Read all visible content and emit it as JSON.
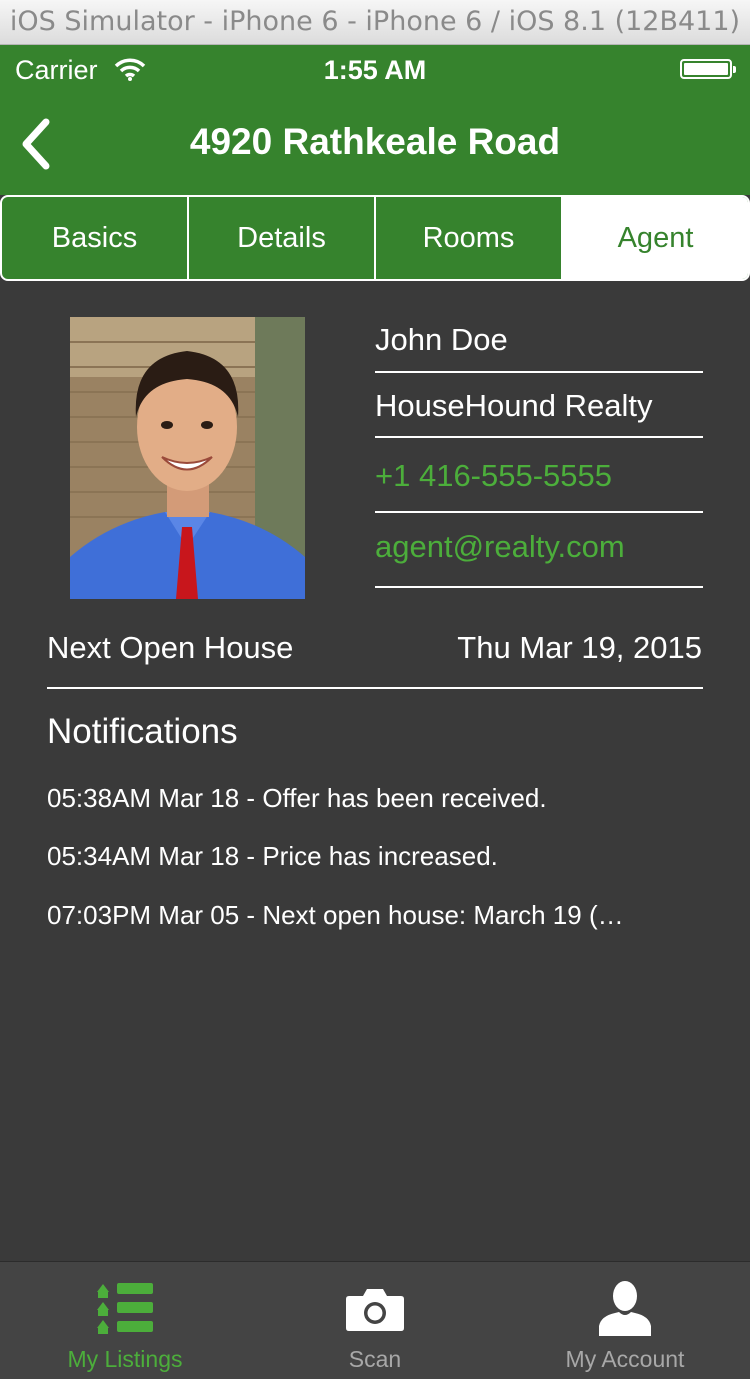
{
  "simulator": {
    "title": "iOS Simulator - iPhone 6 - iPhone 6 / iOS 8.1 (12B411)"
  },
  "status_bar": {
    "carrier": "Carrier",
    "time": "1:55 AM"
  },
  "nav": {
    "title": "4920 Rathkeale Road"
  },
  "tabs": [
    {
      "label": "Basics",
      "active": false
    },
    {
      "label": "Details",
      "active": false
    },
    {
      "label": "Rooms",
      "active": false
    },
    {
      "label": "Agent",
      "active": true
    }
  ],
  "agent": {
    "name": "John Doe",
    "company": "HouseHound Realty",
    "phone": "+1 416-555-5555",
    "email": "agent@realty.com"
  },
  "open_house": {
    "label": "Next Open House",
    "date": "Thu Mar 19, 2015"
  },
  "notifications": {
    "heading": "Notifications",
    "items": [
      "05:38AM Mar 18 - Offer has been received.",
      "05:34AM Mar 18 - Price has increased.",
      "07:03PM Mar 05 - Next open house: March 19 (…"
    ]
  },
  "tab_bar": [
    {
      "label": "My Listings",
      "icon": "list-icon",
      "active": true
    },
    {
      "label": "Scan",
      "icon": "camera-icon",
      "active": false
    },
    {
      "label": "My Account",
      "icon": "person-icon",
      "active": false
    }
  ],
  "colors": {
    "brand_green": "#36832d",
    "link_green": "#4cae3b",
    "background": "#3a3a3a"
  }
}
